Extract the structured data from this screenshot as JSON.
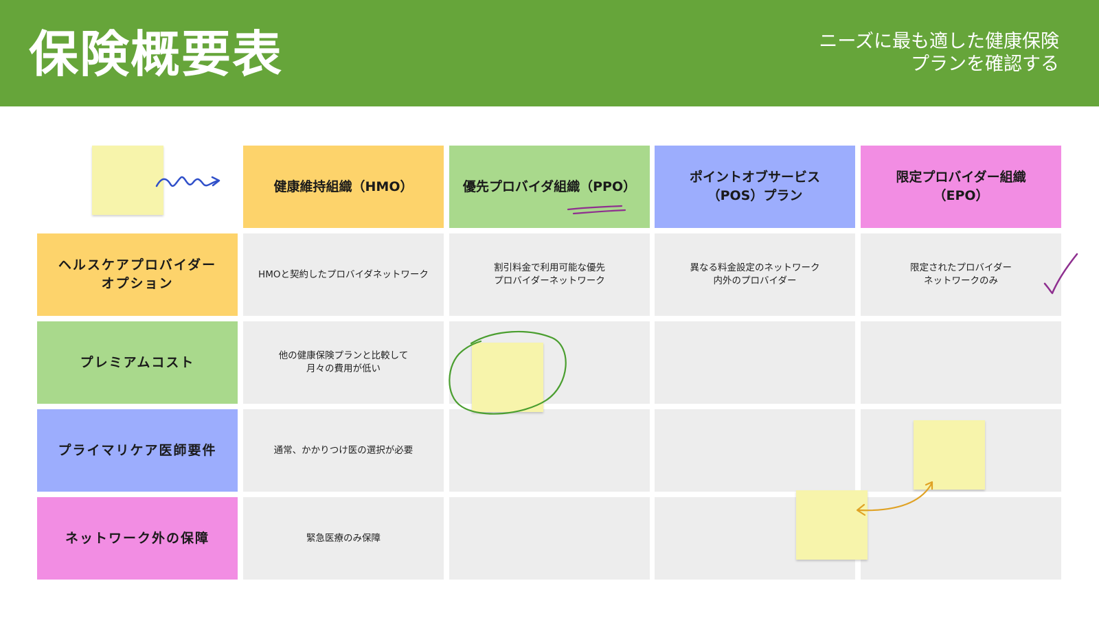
{
  "header": {
    "title": "保険概要表",
    "subtitle_lines": [
      "ニーズに最も適した健康保険",
      "プランを確認する"
    ]
  },
  "table": {
    "columns": [
      {
        "lines": [
          "健康維持組織（HMO）"
        ]
      },
      {
        "lines": [
          "優先プロバイダ組織（PPO）"
        ]
      },
      {
        "lines": [
          "ポイントオブサービス",
          "（POS）プラン"
        ]
      },
      {
        "lines": [
          "限定プロバイダー組織",
          "（EPO）"
        ]
      }
    ],
    "rows": [
      {
        "label_lines": [
          "ヘルスケアプロバイダー",
          "オプション"
        ],
        "cells": [
          [
            "HMOと契約したプロバイダネットワーク"
          ],
          [
            "割引料金で利用可能な優先",
            "プロバイダーネットワーク"
          ],
          [
            "異なる料金設定のネットワーク",
            "内外のプロバイダー"
          ],
          [
            "限定されたプロバイダー",
            "ネットワークのみ"
          ]
        ]
      },
      {
        "label_lines": [
          "プレミアムコスト"
        ],
        "cells": [
          [
            "他の健康保険プランと比較して",
            "月々の費用が低い"
          ],
          [],
          [],
          []
        ]
      },
      {
        "label_lines": [
          "プライマリケア医師要件"
        ],
        "cells": [
          [
            "通常、かかりつけ医の選択が必要"
          ],
          [],
          [],
          []
        ]
      },
      {
        "label_lines": [
          "ネットワーク外の保障"
        ],
        "cells": [
          [
            "緊急医療のみ保障"
          ],
          [],
          [],
          []
        ]
      }
    ]
  },
  "colors": {
    "banner": "#66a53a",
    "yellow": "#fdd36b",
    "green": "#a9d98c",
    "blue": "#9cadfd",
    "pink": "#f28de3",
    "sticky": "#f7f4ab",
    "cell_bg": "#ededed"
  },
  "icons": [
    "squiggle-arrow-icon",
    "underline-scribble-icon",
    "check-mark-icon",
    "circle-scribble-icon",
    "double-arrow-icon"
  ]
}
